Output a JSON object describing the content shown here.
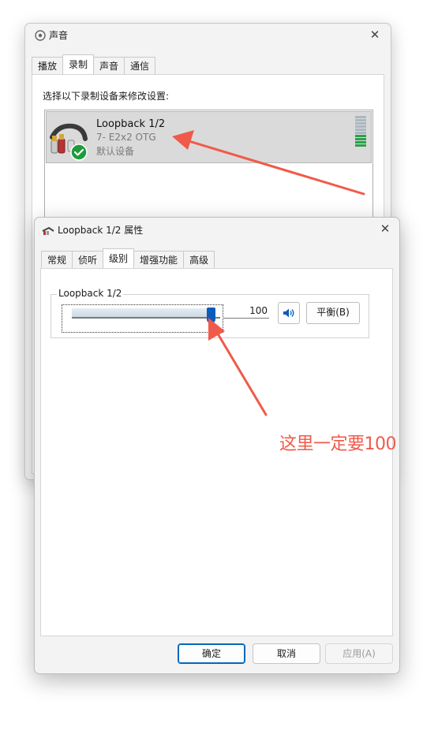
{
  "sound_window": {
    "title": "声音",
    "tabs": [
      "播放",
      "录制",
      "声音",
      "通信"
    ],
    "active_tab_index": 1,
    "instruction": "选择以下录制设备来修改设置:",
    "device": {
      "name": "Loopback 1/2",
      "subtitle": "7- E2x2 OTG",
      "status": "默认设备",
      "icon": "rca-cable-icon",
      "badge_icon": "green-check-icon"
    }
  },
  "props_window": {
    "title": "Loopback 1/2 属性",
    "tabs": [
      "常规",
      "侦听",
      "级别",
      "增强功能",
      "高级"
    ],
    "active_tab_index": 2,
    "level_group": {
      "label": "Loopback 1/2",
      "volume_value": "100",
      "volume_fraction": 1.0,
      "balance_label": "平衡(B)",
      "mute_icon": "speaker-icon"
    },
    "buttons": {
      "ok": "确定",
      "cancel": "取消",
      "apply": "应用(A)"
    }
  },
  "annotation": {
    "text": "这里一定要100",
    "color": "#f05a4a"
  }
}
